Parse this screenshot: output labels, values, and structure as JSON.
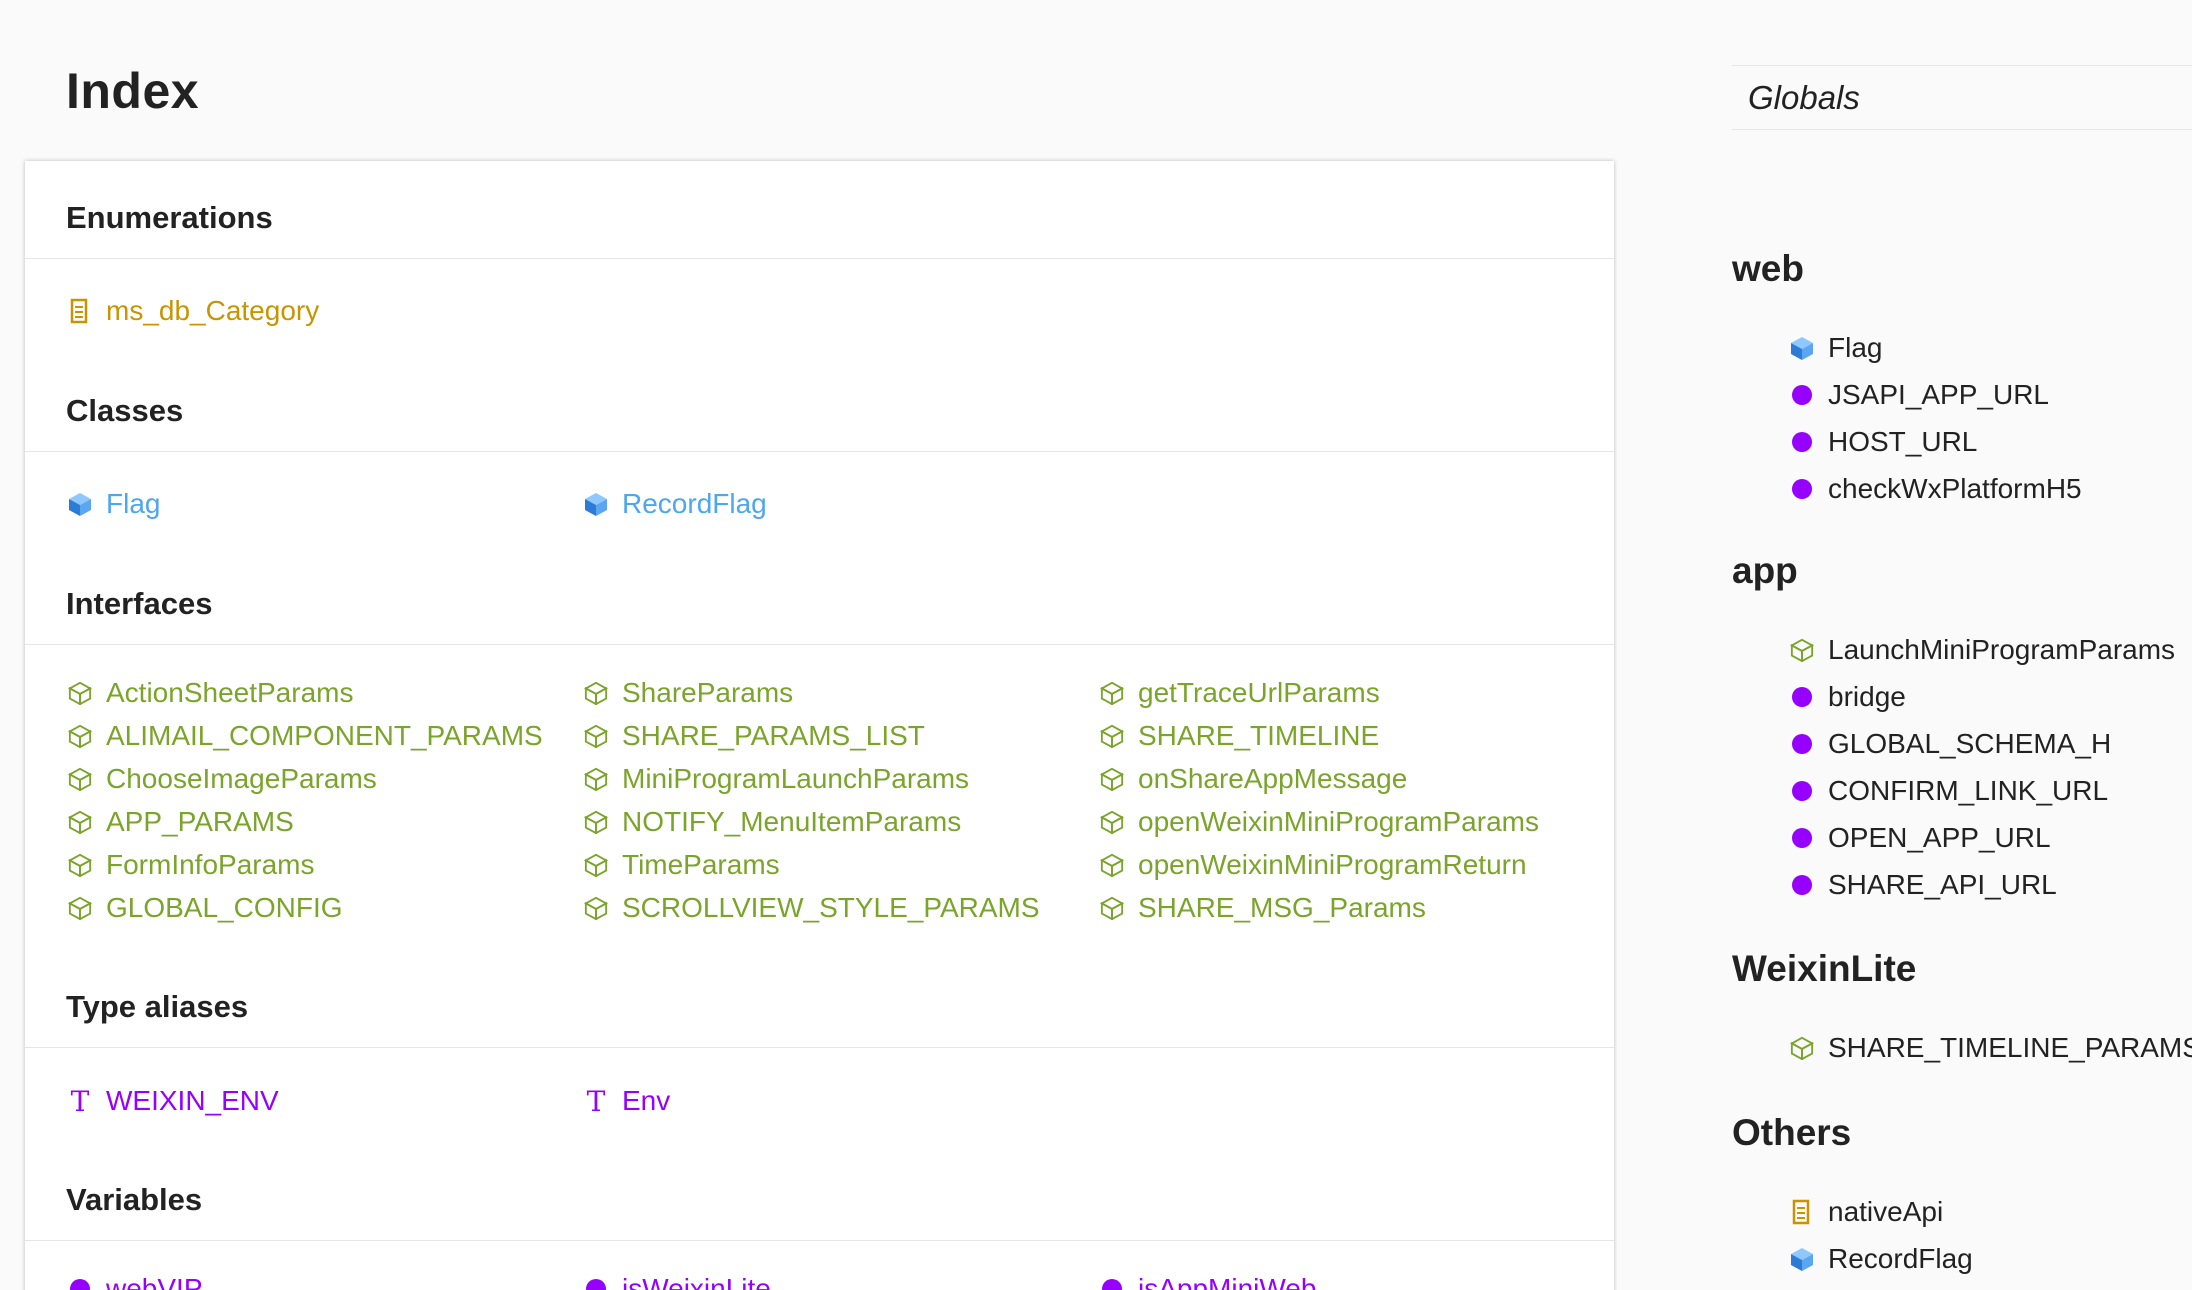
{
  "page_title": "Index",
  "sections": {
    "enumerations": {
      "title": "Enumerations",
      "items": [
        "ms_db_Category"
      ]
    },
    "classes": {
      "title": "Classes",
      "items": [
        "Flag",
        "RecordFlag"
      ]
    },
    "interfaces": {
      "title": "Interfaces",
      "col1": [
        "ActionSheetParams",
        "ALIMAIL_COMPONENT_PARAMS",
        "ChooseImageParams",
        "APP_PARAMS",
        "FormInfoParams",
        "GLOBAL_CONFIG"
      ],
      "col2": [
        "ShareParams",
        "SHARE_PARAMS_LIST",
        "MiniProgramLaunchParams",
        "NOTIFY_MenuItemParams",
        "TimeParams",
        "SCROLLVIEW_STYLE_PARAMS"
      ],
      "col3": [
        "getTraceUrlParams",
        "SHARE_TIMELINE",
        "onShareAppMessage",
        "openWeixinMiniProgramParams",
        "openWeixinMiniProgramReturn",
        "SHARE_MSG_Params"
      ]
    },
    "type_aliases": {
      "title": "Type aliases",
      "items": [
        "WEIXIN_ENV",
        "Env"
      ]
    },
    "variables": {
      "title": "Variables",
      "items": [
        "webVIP",
        "isWeixinLite",
        "isAppMiniWeb"
      ]
    }
  },
  "sidebar": {
    "globals_label": "Globals",
    "groups": [
      {
        "title": "web",
        "items": [
          {
            "icon": "class-icon",
            "label": "Flag"
          },
          {
            "icon": "variable-dot-icon",
            "label": "JSAPI_APP_URL"
          },
          {
            "icon": "variable-dot-icon",
            "label": "HOST_URL"
          },
          {
            "icon": "variable-dot-icon",
            "label": "checkWxPlatformH5"
          }
        ]
      },
      {
        "title": "app",
        "items": [
          {
            "icon": "interface-icon",
            "label": "LaunchMiniProgramParams"
          },
          {
            "icon": "variable-dot-icon",
            "label": "bridge"
          },
          {
            "icon": "variable-dot-icon",
            "label": "GLOBAL_SCHEMA_H"
          },
          {
            "icon": "variable-dot-icon",
            "label": "CONFIRM_LINK_URL"
          },
          {
            "icon": "variable-dot-icon",
            "label": "OPEN_APP_URL"
          },
          {
            "icon": "variable-dot-icon",
            "label": "SHARE_API_URL"
          }
        ]
      },
      {
        "title": "WeixinLite",
        "items": [
          {
            "icon": "interface-icon",
            "label": "SHARE_TIMELINE_PARAMS"
          }
        ]
      },
      {
        "title": "Others",
        "items": [
          {
            "icon": "enum-icon",
            "label": "nativeApi"
          },
          {
            "icon": "class-icon",
            "label": "RecordFlag"
          }
        ]
      }
    ]
  },
  "colors": {
    "enum": "#c99400",
    "class": "#4da6f0",
    "interface": "#7ba42b",
    "variable": "#9600ff"
  }
}
